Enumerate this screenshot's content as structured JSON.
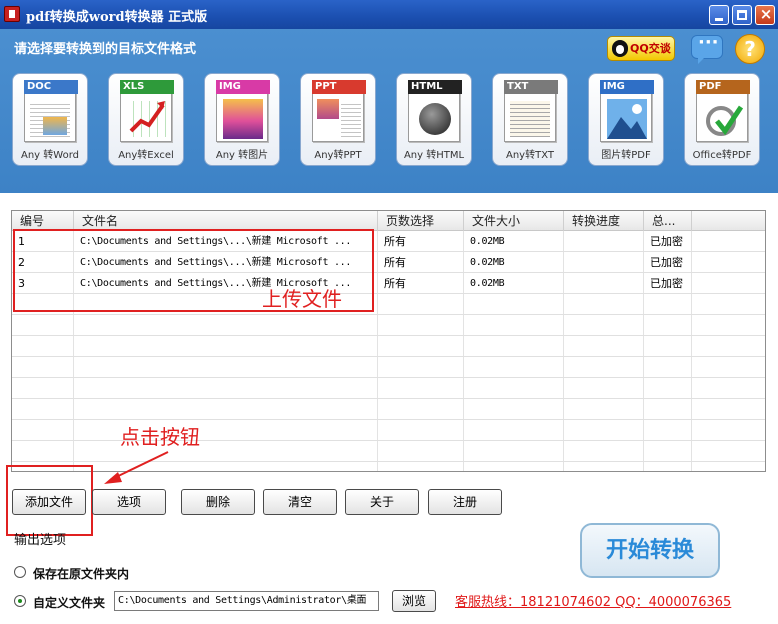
{
  "window": {
    "title": "pdf转换成word转换器 正式版"
  },
  "header": {
    "prompt": "请选择要转换到的目标文件格式",
    "qq_label": "QQ交谈",
    "help_label": "?"
  },
  "formats": [
    {
      "tag": "DOC",
      "label": "Any 转Word",
      "color": "#3b78c9"
    },
    {
      "tag": "XLS",
      "label": "Any转Excel",
      "color": "#2e9a3a"
    },
    {
      "tag": "IMG",
      "label": "Any 转图片",
      "color": "#d83aa6"
    },
    {
      "tag": "PPT",
      "label": "Any转PPT",
      "color": "#d83a2e"
    },
    {
      "tag": "HTML",
      "label": "Any 转HTML",
      "color": "#222222"
    },
    {
      "tag": "TXT",
      "label": "Any转TXT",
      "color": "#7a7a7a"
    },
    {
      "tag": "IMG",
      "label": "图片转PDF",
      "color": "#2f6fc6"
    },
    {
      "tag": "PDF",
      "label": "Office转PDF",
      "color": "#b5651d"
    }
  ],
  "table": {
    "columns": [
      "编号",
      "文件名",
      "页数选择",
      "文件大小",
      "转换进度",
      "总..."
    ],
    "rows": [
      [
        "1",
        "C:\\Documents and Settings\\...\\新建 Microsoft ...",
        "所有",
        "0.02MB",
        "",
        "已加密"
      ],
      [
        "2",
        "C:\\Documents and Settings\\...\\新建 Microsoft ...",
        "所有",
        "0.02MB",
        "",
        "已加密"
      ],
      [
        "3",
        "C:\\Documents and Settings\\...\\新建 Microsoft ...",
        "所有",
        "0.02MB",
        "",
        "已加密"
      ]
    ]
  },
  "annotations": {
    "upload": "上传文件",
    "click": "点击按钮"
  },
  "buttons": [
    "添加文件",
    "选项",
    "删除",
    "清空",
    "关于",
    "注册"
  ],
  "output": {
    "label": "输出选项",
    "option_original": "保存在原文件夹内",
    "option_custom": "自定义文件夹",
    "path": "C:\\Documents and Settings\\Administrator\\桌面",
    "browse": "浏览",
    "hotline": "客服热线：18121074602 QQ：4000076365",
    "start": "开始转换"
  }
}
